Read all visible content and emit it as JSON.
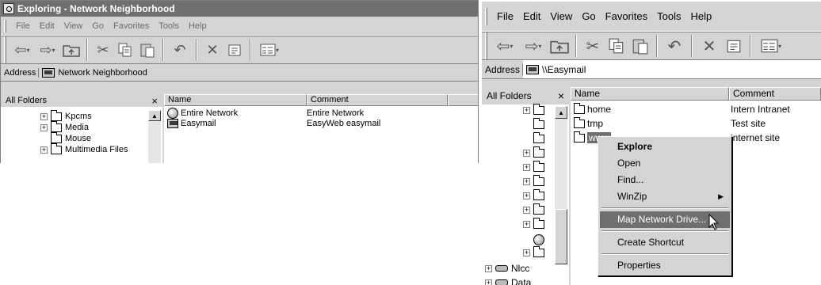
{
  "window1": {
    "title": "Exploring - Network Neighborhood",
    "menu": [
      "File",
      "Edit",
      "View",
      "Go",
      "Favorites",
      "Tools",
      "Help"
    ],
    "address_label": "Address",
    "address_value": "Network Neighborhood",
    "tree_header": "All Folders",
    "tree_close": "×",
    "tree_items": [
      "Kpcms",
      "Media",
      "Mouse",
      "Multimedia Files"
    ],
    "columns": [
      "Name",
      "Comment"
    ],
    "rows": [
      {
        "name": "Entire Network",
        "comment": "Entire Network",
        "icon": "network-globe-icon"
      },
      {
        "name": "Easymail",
        "comment": "EasyWeb easymail",
        "icon": "computer-icon"
      }
    ]
  },
  "window2": {
    "menu": [
      "File",
      "Edit",
      "View",
      "Go",
      "Favorites",
      "Tools",
      "Help"
    ],
    "address_label": "Address",
    "address_value": "\\\\Easymail",
    "tree_header": "All Folders",
    "tree_close": "×",
    "tree_items": [
      "Nlcc",
      "Data"
    ],
    "columns": [
      "Name",
      "Comment"
    ],
    "rows": [
      {
        "name": "home",
        "comment": "Intern Intranet"
      },
      {
        "name": "tmp",
        "comment": "Test site"
      },
      {
        "name": "www",
        "comment": "internet site"
      }
    ],
    "context_menu": [
      {
        "label": "Explore",
        "bold": true
      },
      {
        "label": "Open"
      },
      {
        "label": "Find..."
      },
      {
        "label": "WinZip",
        "submenu": true
      },
      {
        "separator": true
      },
      {
        "label": "Map Network Drive...",
        "highlighted": true
      },
      {
        "separator": true
      },
      {
        "label": "Create Shortcut"
      },
      {
        "separator": true
      },
      {
        "label": "Properties"
      }
    ]
  },
  "colors": {
    "face": "#d4d4d4",
    "titlebar": "#6f6f6f",
    "highlight": "#6f6f6f"
  }
}
